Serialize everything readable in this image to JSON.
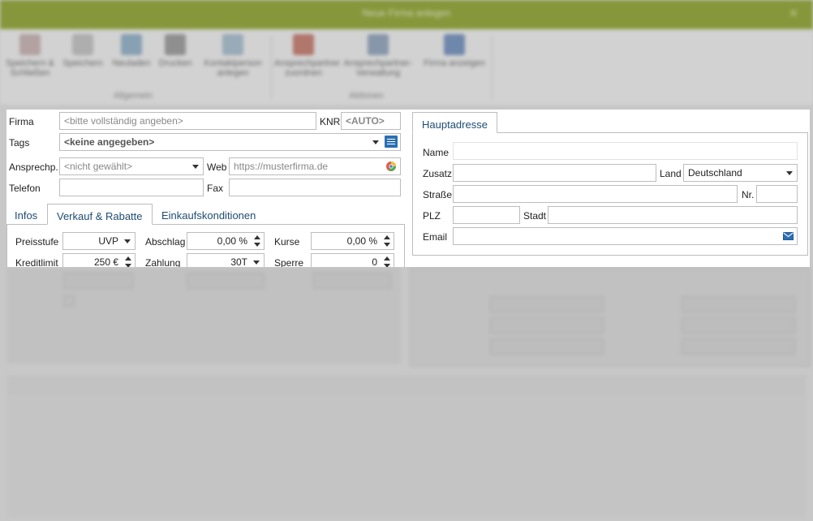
{
  "window": {
    "title": "Neue Firma anlegen",
    "close_glyph": "✕"
  },
  "ribbon": {
    "buttons": [
      {
        "label": "Speichern & Schließen",
        "icon": "save-close-icon"
      },
      {
        "label": "Speichern",
        "icon": "save-icon"
      },
      {
        "label": "Neuladen",
        "icon": "reload-icon"
      },
      {
        "label": "Drucken",
        "icon": "print-icon"
      },
      {
        "label": "Kontaktperson anlegen",
        "icon": "contact-add-icon"
      },
      {
        "label": "Ansprechpartner zuordnen",
        "icon": "assign-icon"
      },
      {
        "label": "Ansprechpartner-Verwaltung",
        "icon": "manage-icon"
      },
      {
        "label": "Firma anzeigen",
        "icon": "show-icon"
      }
    ],
    "groups": [
      "Allgemein",
      "Aktionen"
    ]
  },
  "form": {
    "firma_label": "Firma",
    "firma_placeholder": "<bitte vollständig angeben>",
    "knr_label": "KNR",
    "knr_value": "<AUTO>",
    "tags_label": "Tags",
    "tags_placeholder": "<keine angegeben>",
    "ansprech_label": "Ansprechp.",
    "ansprech_placeholder": "<nicht gewählt>",
    "web_label": "Web",
    "web_placeholder": "https://musterfirma.de",
    "telefon_label": "Telefon",
    "telefon_value": "",
    "fax_label": "Fax",
    "fax_value": ""
  },
  "tabs": [
    {
      "label": "Infos",
      "active": false
    },
    {
      "label": "Verkauf & Rabatte",
      "active": true
    },
    {
      "label": "Einkaufskonditionen",
      "active": false
    }
  ],
  "sales": {
    "preisstufe_label": "Preisstufe",
    "preisstufe_value": "UVP",
    "abschlag_label": "Abschlag",
    "abschlag_value": "0,00 %",
    "kurse_label": "Kurse",
    "kurse_value": "0,00 %",
    "kreditlimit_label": "Kreditlimit",
    "kreditlimit_value": "250 €",
    "zahlung_label": "Zahlung",
    "zahlung_value": "30T",
    "sperre_label": "Sperre",
    "sperre_value": "0"
  },
  "address": {
    "tab_label": "Hauptadresse",
    "name_label": "Name",
    "name_value": "",
    "zusatz_label": "Zusatz",
    "zusatz_value": "",
    "land_label": "Land",
    "land_value": "Deutschland",
    "strasse_label": "Straße",
    "strasse_value": "",
    "nr_label": "Nr.",
    "nr_value": "",
    "plz_label": "PLZ",
    "plz_value": "",
    "stadt_label": "Stadt",
    "stadt_value": "",
    "email_label": "Email",
    "email_value": ""
  },
  "colors": {
    "titlebar": "#8ea52a",
    "tab_text": "#1e4c73",
    "accent_blue": "#2c6fb2"
  }
}
